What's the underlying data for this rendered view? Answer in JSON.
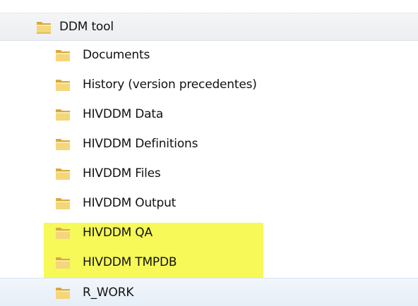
{
  "tree": {
    "root": {
      "label": "DDM tool",
      "icon": "folder-icon"
    },
    "children": [
      {
        "label": "Documents",
        "icon": "folder-icon",
        "highlighted": false
      },
      {
        "label": "History (version precedentes)",
        "icon": "folder-icon",
        "highlighted": false
      },
      {
        "label": "HIVDDM Data",
        "icon": "folder-icon",
        "highlighted": false
      },
      {
        "label": "HIVDDM Definitions",
        "icon": "folder-icon",
        "highlighted": false
      },
      {
        "label": "HIVDDM Files",
        "icon": "folder-icon",
        "highlighted": false
      },
      {
        "label": "HIVDDM Output",
        "icon": "folder-icon",
        "highlighted": false
      },
      {
        "label": "HIVDDM QA",
        "icon": "folder-icon",
        "highlighted": true
      },
      {
        "label": "HIVDDM TMPDB",
        "icon": "folder-icon",
        "highlighted": true
      },
      {
        "label": "R_WORK",
        "icon": "folder-icon",
        "highlighted": true
      }
    ]
  },
  "colors": {
    "highlight": "#f5f83a",
    "folder_front": "#f3d77a",
    "folder_back": "#d9a93c",
    "hover_row": "#e6eef8",
    "root_row": "#eceef1"
  }
}
